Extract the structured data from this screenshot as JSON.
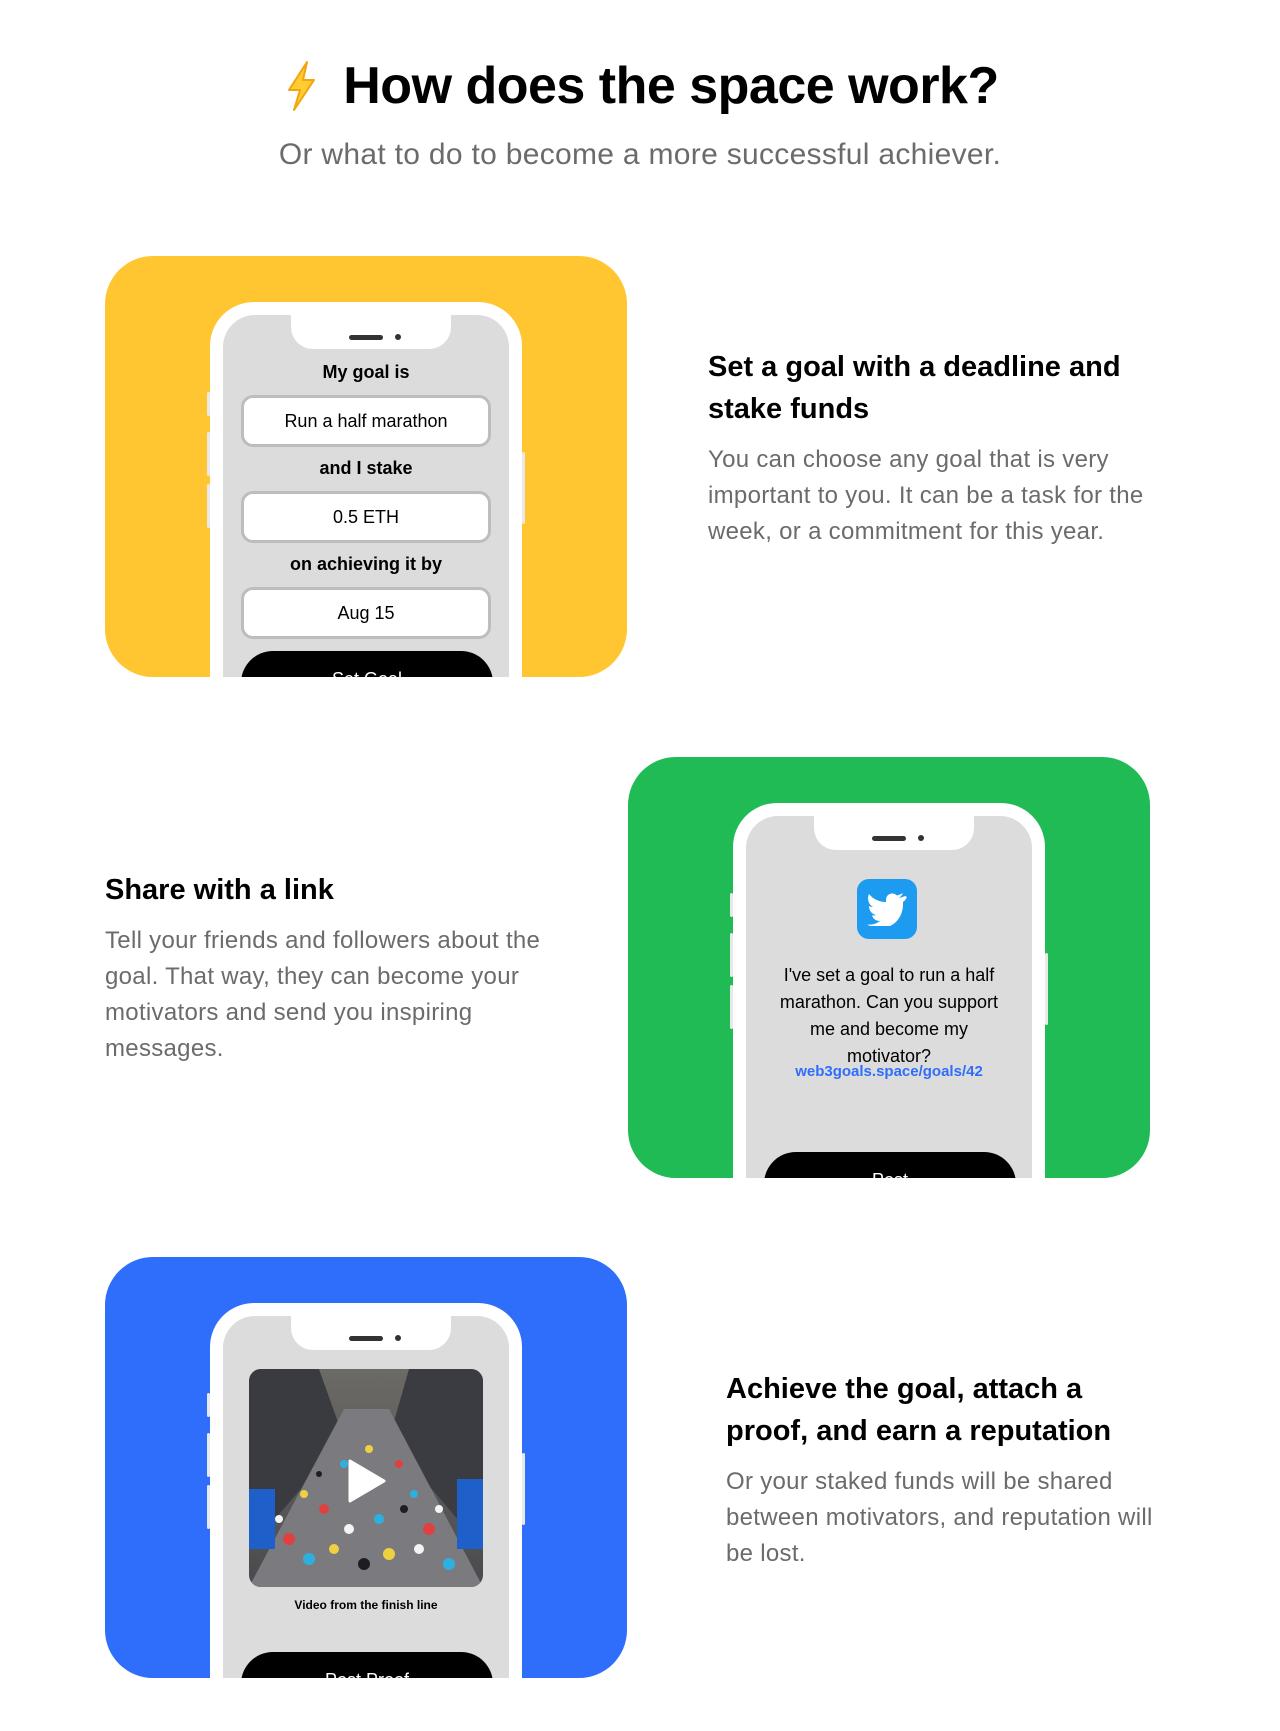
{
  "header": {
    "icon": "lightning-bolt-icon",
    "title": "How does the space work?",
    "subtitle": "Or what to do to become a more successful achiever."
  },
  "colors": {
    "yellow": "#ffc632",
    "green": "#20bb55",
    "blue": "#2f6dfb",
    "link": "#2f6dfb"
  },
  "steps": [
    {
      "title": "Set a goal with a deadline and stake funds",
      "description": "You can choose any goal that is very important to you. It can be a task for the week, or a commitment for this year.",
      "phone": {
        "goal_label": "My goal is",
        "goal_value": "Run a half marathon",
        "stake_label": "and I stake",
        "stake_value": "0.5 ETH",
        "deadline_label": "on achieving it by",
        "deadline_value": "Aug 15",
        "button": "Set Goal"
      }
    },
    {
      "title": "Share with a link",
      "description": "Tell your friends and followers about the goal. That way, they can become your motivators and send you inspiring messages.",
      "phone": {
        "icon": "twitter-icon",
        "message": "I've set a goal to run a half marathon. Can you support me and become my motivator?",
        "link": "web3goals.space/goals/42",
        "button": "Post"
      }
    },
    {
      "title": "Achieve the goal, attach a proof, and earn a reputation",
      "description": "Or your staked funds will be shared between motivators, and reputation will be lost.",
      "phone": {
        "video_icon": "play-icon",
        "caption": "Video from the finish line",
        "button": "Post Proof"
      }
    }
  ]
}
